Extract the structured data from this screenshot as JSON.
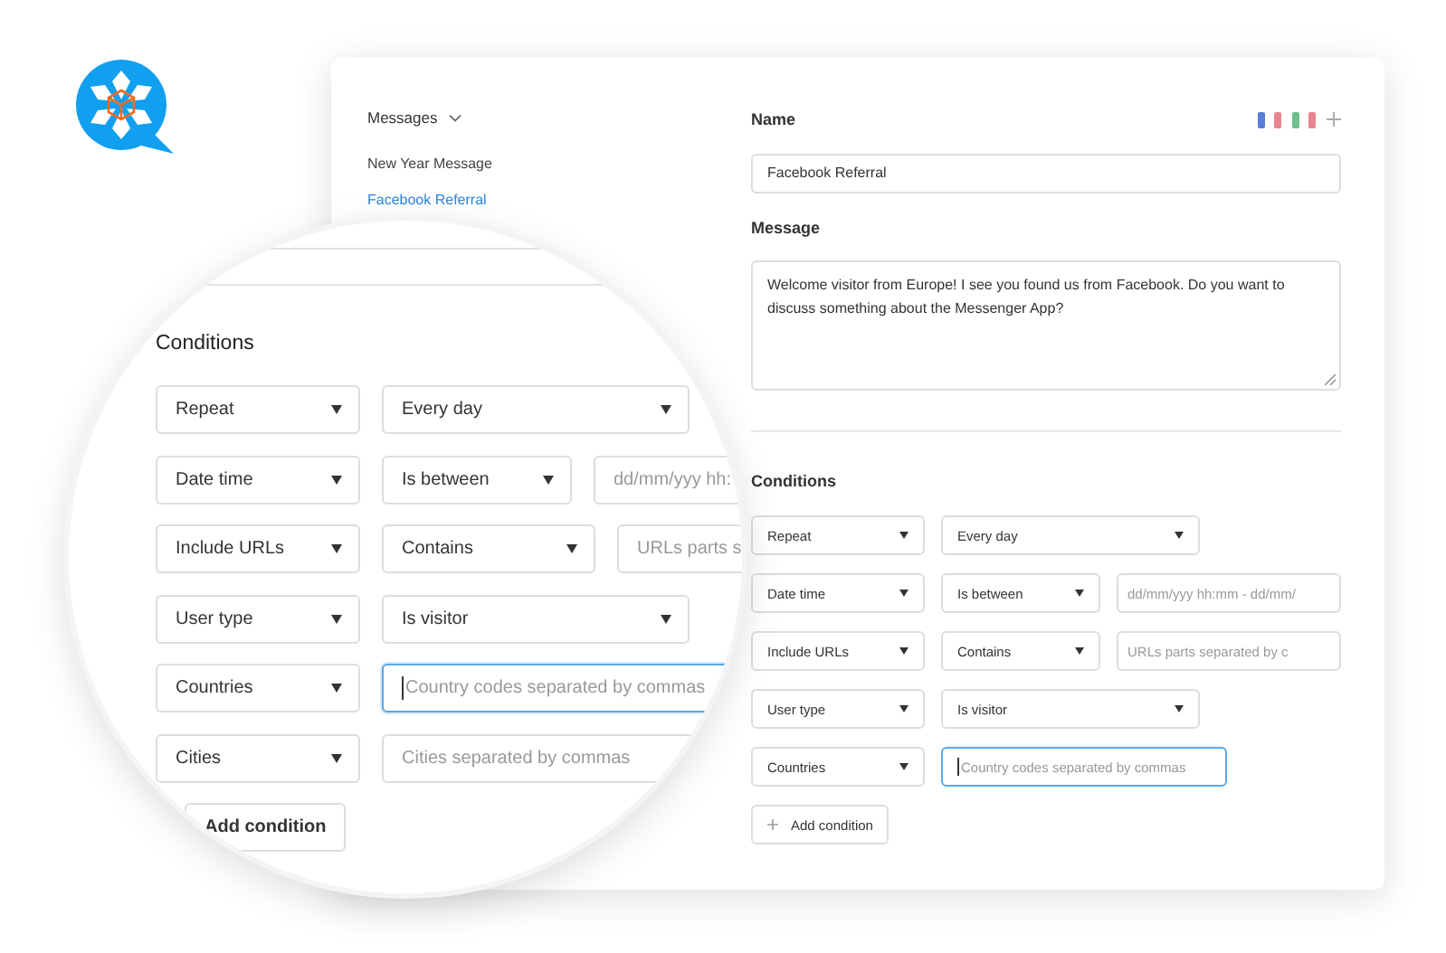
{
  "sidebar": {
    "title": "Messages",
    "items": [
      {
        "label": "New Year Message",
        "selected": false
      },
      {
        "label": "Facebook Referral",
        "selected": true
      }
    ]
  },
  "form": {
    "name_label": "Name",
    "flags": [
      {
        "stripes": [
          {
            "color": "#5b7fd6"
          },
          {
            "color": "#e8848f"
          }
        ]
      },
      {
        "stripes": [
          {
            "color": "#6cc08a"
          },
          {
            "color": "#e8848f"
          }
        ]
      }
    ],
    "name_value": "Facebook Referral",
    "message_label": "Message",
    "message_value": "Welcome visitor from Europe! I see you found us from Facebook. Do you want to discuss something about the Messenger App?",
    "conditions_title": "Conditions",
    "conditions": [
      {
        "kind": "select",
        "field": "Repeat",
        "operator": "Every day"
      },
      {
        "kind": "select_value",
        "field": "Date time",
        "operator": "Is between",
        "placeholder": "dd/mm/yyy hh:mm - dd/mm/"
      },
      {
        "kind": "select_value",
        "field": "Include URLs",
        "operator": "Contains",
        "placeholder": "URLs parts separated by c"
      },
      {
        "kind": "select",
        "field": "User type",
        "operator": "Is visitor"
      },
      {
        "kind": "text",
        "field": "Countries",
        "placeholder": "Country codes separated by commas",
        "focused": true
      }
    ],
    "add_button": "Add condition"
  },
  "magnifier": {
    "conditions_title": "Conditions",
    "conditions": [
      {
        "kind": "select",
        "field": "Repeat",
        "operator": "Every day"
      },
      {
        "kind": "select_value",
        "field": "Date time",
        "operator": "Is between",
        "placeholder": "dd/mm/yyy hh:"
      },
      {
        "kind": "select_value",
        "field": "Include URLs",
        "operator": "Contains",
        "placeholder": "URLs parts s"
      },
      {
        "kind": "select",
        "field": "User type",
        "operator": "Is visitor"
      },
      {
        "kind": "text",
        "field": "Countries",
        "placeholder": "Country codes separated by commas",
        "focused": true
      },
      {
        "kind": "text",
        "field": "Cities",
        "placeholder": "Cities separated by commas",
        "focused": false
      }
    ],
    "add_button": "Add condition"
  }
}
